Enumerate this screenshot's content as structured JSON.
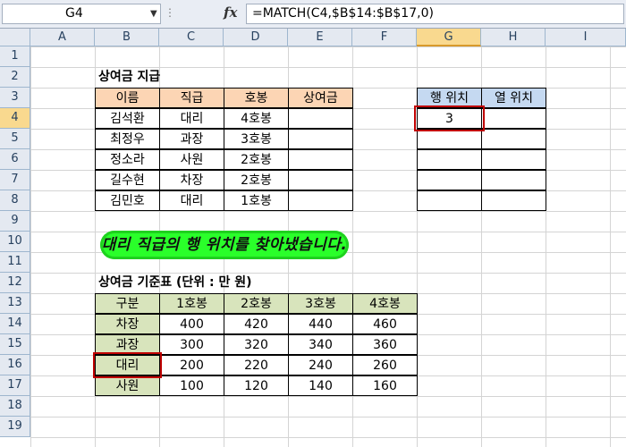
{
  "formula_bar": {
    "name_box": "G4",
    "fx_label": "fx",
    "formula": "=MATCH(C4,$B$14:$B$17,0)"
  },
  "sheet": {
    "columns": [
      "A",
      "B",
      "C",
      "D",
      "E",
      "F",
      "G",
      "H",
      "I"
    ],
    "rows": [
      "1",
      "2",
      "3",
      "4",
      "5",
      "6",
      "7",
      "8",
      "9",
      "10",
      "11",
      "12",
      "13",
      "14",
      "15",
      "16",
      "17",
      "18",
      "19"
    ],
    "selected_column": "G",
    "selected_row": "4"
  },
  "bonus_table": {
    "title": "상여금 지급",
    "headers": [
      "이름",
      "직급",
      "호봉",
      "상여금"
    ],
    "rows": [
      [
        "김석환",
        "대리",
        "4호봉",
        ""
      ],
      [
        "최정우",
        "과장",
        "3호봉",
        ""
      ],
      [
        "정소라",
        "사원",
        "2호봉",
        ""
      ],
      [
        "길수현",
        "차장",
        "2호봉",
        ""
      ],
      [
        "김민호",
        "대리",
        "1호봉",
        ""
      ]
    ]
  },
  "position_table": {
    "headers": [
      "행 위치",
      "열 위치"
    ],
    "rows": [
      [
        "3",
        ""
      ],
      [
        "",
        ""
      ],
      [
        "",
        ""
      ],
      [
        "",
        ""
      ],
      [
        "",
        ""
      ]
    ]
  },
  "callout": {
    "text": "대리 직급의 행 위치를 찾아냈습니다."
  },
  "standard_table": {
    "title": "상여금 기준표 (단위 : 만 원)",
    "headers": [
      "구분",
      "1호봉",
      "2호봉",
      "3호봉",
      "4호봉"
    ],
    "rows": [
      [
        "차장",
        "400",
        "420",
        "440",
        "460"
      ],
      [
        "과장",
        "300",
        "320",
        "340",
        "360"
      ],
      [
        "대리",
        "200",
        "220",
        "240",
        "260"
      ],
      [
        "사원",
        "100",
        "120",
        "140",
        "160"
      ]
    ]
  },
  "colors": {
    "header_orange": "#fcd5b4",
    "header_blue": "#c5d9f1",
    "header_green": "#d8e4bc",
    "highlight_red": "#c00000",
    "callout_green": "#2aff2a"
  }
}
